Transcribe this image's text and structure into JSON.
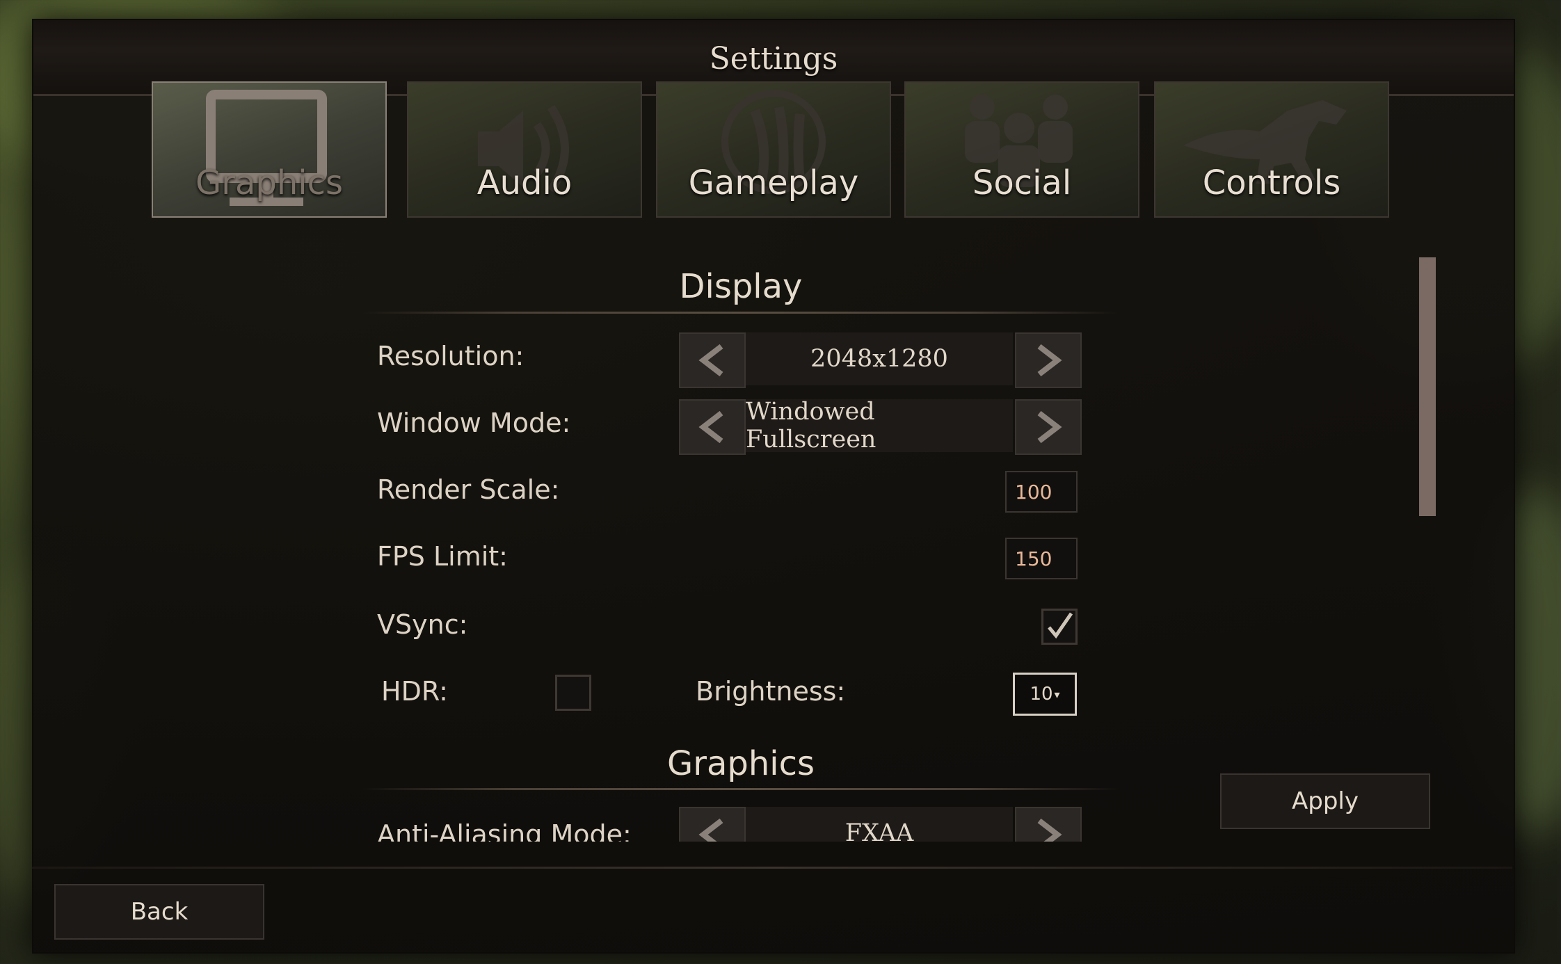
{
  "window": {
    "title": "Settings"
  },
  "tabs": [
    {
      "label": "Graphics",
      "icon": "monitor-icon",
      "active": true
    },
    {
      "label": "Audio",
      "icon": "speaker-icon",
      "active": false
    },
    {
      "label": "Gameplay",
      "icon": "dino-claw-icon",
      "active": false
    },
    {
      "label": "Social",
      "icon": "group-icon",
      "active": false
    },
    {
      "label": "Controls",
      "icon": "dinosaur-icon",
      "active": false
    }
  ],
  "display": {
    "heading": "Display",
    "resolution": {
      "label": "Resolution:",
      "value": "2048x1280"
    },
    "window_mode": {
      "label": "Window Mode:",
      "value": "Windowed Fullscreen"
    },
    "render_scale": {
      "label": "Render Scale:",
      "value": "100"
    },
    "fps_limit": {
      "label": "FPS Limit:",
      "value": "150"
    },
    "vsync": {
      "label": "VSync:",
      "checked": true
    },
    "hdr": {
      "label": "HDR:",
      "checked": false
    },
    "brightness": {
      "label": "Brightness:",
      "value": "10"
    }
  },
  "graphics": {
    "heading": "Graphics",
    "anti_aliasing": {
      "label": "Anti-Aliasing Mode:",
      "value": "FXAA"
    }
  },
  "buttons": {
    "apply": "Apply",
    "back": "Back"
  },
  "colors": {
    "accent": "#e8b898",
    "text": "#e6dccd",
    "scrollbar": "#7a6a63"
  }
}
